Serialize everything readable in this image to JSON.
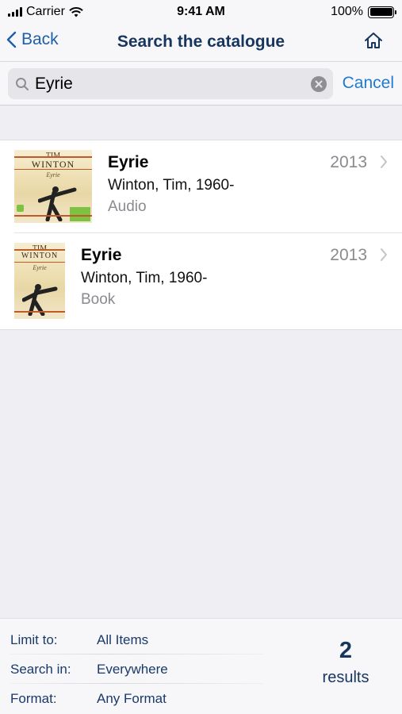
{
  "status_bar": {
    "carrier": "Carrier",
    "time": "9:41 AM",
    "battery": "100%"
  },
  "nav": {
    "back_label": "Back",
    "title": "Search the catalogue"
  },
  "search": {
    "query": "Eyrie",
    "cancel_label": "Cancel"
  },
  "results": [
    {
      "title": "Eyrie",
      "author": "Winton, Tim, 1960-",
      "format": "Audio",
      "year": "2013",
      "cover": {
        "line1": "TIM",
        "line2": "WINTON",
        "line3": "Eyrie"
      }
    },
    {
      "title": "Eyrie",
      "author": "Winton, Tim, 1960-",
      "format": "Book",
      "year": "2013",
      "cover": {
        "line1": "TIM",
        "line2": "WINTON",
        "line3": "Eyrie"
      }
    }
  ],
  "filters": {
    "limit_label": "Limit to:",
    "limit_value": "All Items",
    "search_in_label": "Search in:",
    "search_in_value": "Everywhere",
    "format_label": "Format:",
    "format_value": "Any Format"
  },
  "summary": {
    "count": "2",
    "label": "results"
  },
  "colors": {
    "accent": "#1f7bd3",
    "title": "#17365f",
    "muted": "#8a8a8f"
  }
}
